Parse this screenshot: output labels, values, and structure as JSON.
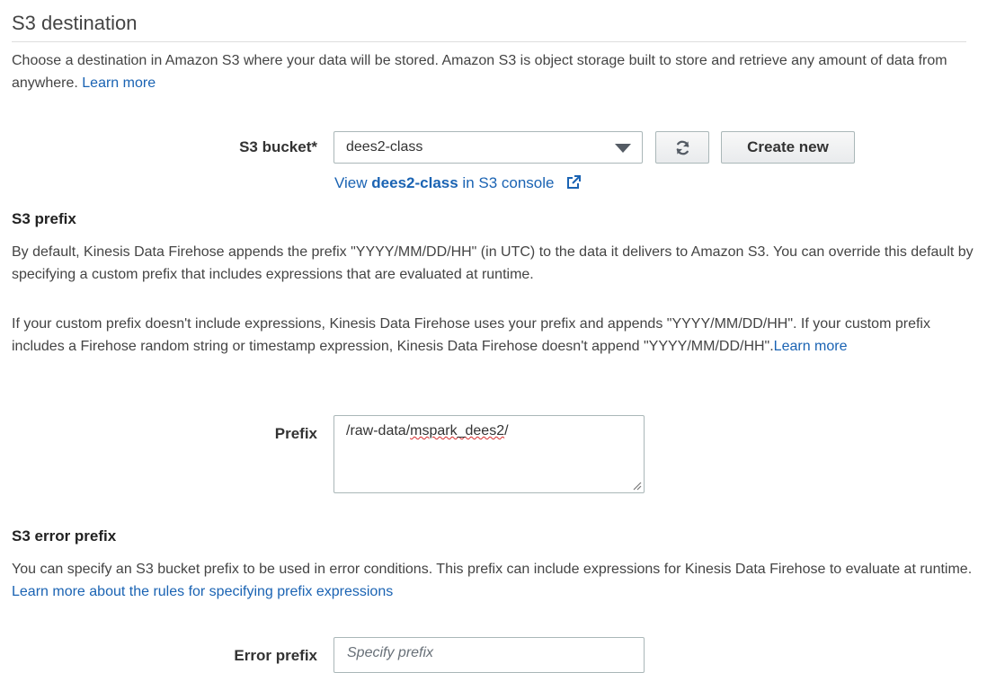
{
  "section": {
    "title": "S3 destination",
    "intro_text": "Choose a destination in Amazon S3 where your data will be stored. Amazon S3 is object storage built to store and retrieve any amount of data from anywhere.",
    "intro_link": "Learn more"
  },
  "bucket": {
    "label": "S3 bucket*",
    "selected_value": "dees2-class",
    "create_label": "Create new",
    "console_link_prefix": "View",
    "console_link_bucket": "dees2-class",
    "console_link_suffix": "in S3 console"
  },
  "prefix_section": {
    "heading": "S3 prefix",
    "paragraph1": "By default, Kinesis Data Firehose appends the prefix \"YYYY/MM/DD/HH\" (in UTC) to the data it delivers to Amazon S3. You can override this default by specifying a custom prefix that includes expressions that are evaluated at runtime.",
    "paragraph2": "If your custom prefix doesn't include expressions, Kinesis Data Firehose uses your prefix and appends \"YYYY/MM/DD/HH\". If your custom prefix includes a Firehose random string or timestamp expression, Kinesis Data Firehose doesn't append \"YYYY/MM/DD/HH\".",
    "paragraph2_link": "Learn more",
    "field_label": "Prefix",
    "value_part1": "/raw-data/",
    "value_part2": "mspark_dees2",
    "value_part3": "/"
  },
  "error_section": {
    "heading": "S3 error prefix",
    "paragraph": "You can specify an S3 bucket prefix to be used in error conditions. This prefix can include expressions for Kinesis Data Firehose to evaluate at runtime.",
    "paragraph_link": "Learn more about the rules for specifying prefix expressions",
    "field_label": "Error prefix",
    "placeholder": "Specify prefix"
  },
  "icons": {
    "dropdown": "caret-down-icon",
    "refresh": "refresh-icon",
    "external": "external-link-icon",
    "resize": "resize-grip-icon"
  },
  "colors": {
    "link": "#1a63b3",
    "border": "#aab7b8",
    "spell_error": "#d62c2c"
  }
}
